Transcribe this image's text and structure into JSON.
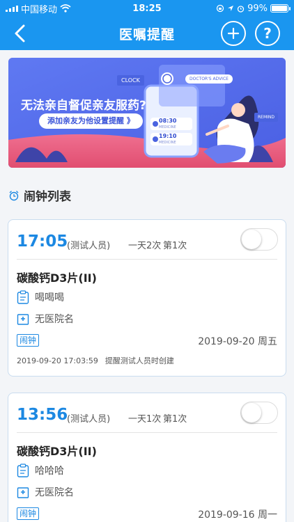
{
  "status_bar": {
    "carrier": "中国移动",
    "time": "18:25",
    "battery_percent": "99%",
    "battery_level": 0.99
  },
  "nav": {
    "title": "医嘱提醒",
    "back_icon": "chevron-left-icon",
    "add_icon": "plus-circle-icon",
    "help_icon": "question-circle-icon",
    "help_glyph": "?"
  },
  "banner": {
    "headline": "无法亲自督促亲友服药?",
    "cta": "添加亲友为他设置提醒 》",
    "clock_tag": "CLOCK",
    "advice_tag": "DOCTOR'S ADVICE",
    "remind_tag": "REMIND",
    "pill_time_1": "08:30",
    "pill_time_2": "19:10",
    "pill_label": "MEDICINE"
  },
  "section": {
    "title": "闹钟列表",
    "icon": "alarm-clock-icon"
  },
  "alarms": [
    {
      "time": "17:05",
      "person": "(测试人员)",
      "frequency": "一天2次",
      "count": "第1次",
      "enabled": false,
      "drug": "碳酸钙D3片(II)",
      "note": "喝喝喝",
      "hospital": "无医院名",
      "tag": "闹钟",
      "date": "2019-09-20 周五",
      "created_time": "2019-09-20 17:03:59",
      "created_text": "提醒测试人员时创建"
    },
    {
      "time": "13:56",
      "person": "(测试人员)",
      "frequency": "一天1次",
      "count": "第1次",
      "enabled": false,
      "drug": "碳酸钙D3片(II)",
      "note": "哈哈哈",
      "hospital": "无医院名",
      "tag": "闹钟",
      "date": "2019-09-16 周一"
    }
  ],
  "colors": {
    "primary": "#1a96f0",
    "accent_text": "#1c88e2",
    "banner_bg": "#6279f1"
  }
}
